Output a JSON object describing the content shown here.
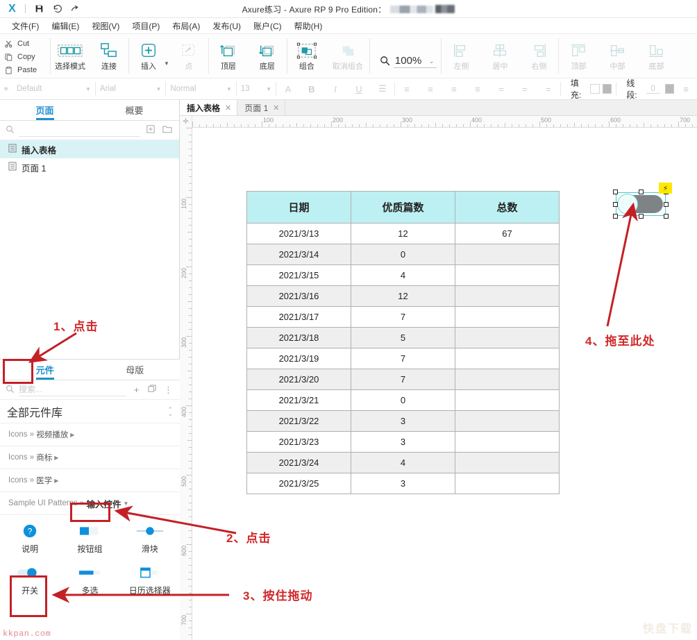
{
  "window": {
    "title": "Axure练习 - Axure RP 9 Pro Edition：",
    "logo": "X",
    "icons": {
      "save": "save-icon",
      "undo": "undo-icon",
      "redo": "redo-icon"
    }
  },
  "menubar": {
    "items": [
      {
        "label": "文件(F)",
        "name": "menu-file"
      },
      {
        "label": "编辑(E)",
        "name": "menu-edit"
      },
      {
        "label": "视图(V)",
        "name": "menu-view"
      },
      {
        "label": "项目(P)",
        "name": "menu-project"
      },
      {
        "label": "布局(A)",
        "name": "menu-layout"
      },
      {
        "label": "发布(U)",
        "name": "menu-publish"
      },
      {
        "label": "账户(C)",
        "name": "menu-account"
      },
      {
        "label": "帮助(H)",
        "name": "menu-help"
      }
    ]
  },
  "toolbar": {
    "clipboard": [
      {
        "label": "Cut",
        "icon": "scissors-icon"
      },
      {
        "label": "Copy",
        "icon": "copy-icon"
      },
      {
        "label": "Paste",
        "icon": "paste-icon"
      }
    ],
    "buttons": [
      {
        "label": "选择模式",
        "icon": "selection-mode-icon",
        "disabled": false
      },
      {
        "label": "连接",
        "icon": "connect-icon",
        "disabled": false
      },
      {
        "label": "插入",
        "icon": "insert-plus-icon",
        "disabled": false
      },
      {
        "label": "点",
        "icon": "point-icon",
        "disabled": true
      },
      {
        "label": "顶层",
        "icon": "bring-to-front-icon",
        "disabled": false
      },
      {
        "label": "底层",
        "icon": "send-to-back-icon",
        "disabled": false
      },
      {
        "label": "组合",
        "icon": "group-icon",
        "disabled": false
      },
      {
        "label": "取消组合",
        "icon": "ungroup-icon",
        "disabled": true
      },
      {
        "label": "左侧",
        "icon": "align-left-icon",
        "disabled": true
      },
      {
        "label": "居中",
        "icon": "align-center-icon",
        "disabled": true
      },
      {
        "label": "右侧",
        "icon": "align-right-icon",
        "disabled": true
      },
      {
        "label": "顶部",
        "icon": "align-top-icon",
        "disabled": true
      },
      {
        "label": "中部",
        "icon": "align-middle-icon",
        "disabled": true
      },
      {
        "label": "底部",
        "icon": "align-bottom-icon",
        "disabled": true
      }
    ],
    "zoom": {
      "value": "100%",
      "icon": "magnifier-icon"
    }
  },
  "formatbar": {
    "style": "Default",
    "font": "Arial",
    "weight": "Normal",
    "size": "13",
    "fill_label": "填充:",
    "line_label": "线段:",
    "line_width": "0"
  },
  "left_panel": {
    "top_tabs": [
      {
        "label": "页面",
        "active": true,
        "name": "tab-pages"
      },
      {
        "label": "概要",
        "active": false,
        "name": "tab-outline"
      }
    ],
    "page_search_placeholder": "",
    "pages": [
      {
        "label": "插入表格",
        "selected": true
      },
      {
        "label": "页面 1",
        "selected": false
      }
    ],
    "bottom_tabs": [
      {
        "label": "元件",
        "active": true,
        "name": "tab-widgets"
      },
      {
        "label": "母版",
        "active": false,
        "name": "tab-masters"
      }
    ],
    "widget_search_placeholder": "搜索...",
    "library_selected": "全部元件库",
    "library_groups": [
      {
        "prefix": "Icons »",
        "name": "视频播放",
        "current": false
      },
      {
        "prefix": "Icons »",
        "name": "商标",
        "current": false
      },
      {
        "prefix": "Icons »",
        "name": "医学",
        "current": false
      },
      {
        "prefix": "Sample UI Patterns »",
        "name": "输入控件",
        "current": true
      }
    ],
    "widgets": [
      {
        "label": "说明",
        "icon": "question-badge-icon"
      },
      {
        "label": "按钮组",
        "icon": "button-group-icon"
      },
      {
        "label": "滑块",
        "icon": "slider-icon"
      },
      {
        "label": "开关",
        "icon": "toggle-switch-icon",
        "highlighted": true
      },
      {
        "label": "多选",
        "icon": "multi-select-icon"
      },
      {
        "label": "日历选择器",
        "icon": "date-picker-icon"
      }
    ]
  },
  "canvas": {
    "tabs": [
      {
        "label": "插入表格",
        "active": true
      },
      {
        "label": "页面 1",
        "active": false
      }
    ],
    "ruler_h_labels": [
      "100",
      "200",
      "300",
      "400",
      "500",
      "600",
      "700"
    ],
    "ruler_v_labels": [
      "100",
      "200",
      "300",
      "400",
      "500",
      "600",
      "700"
    ],
    "selected_widget": {
      "name": "toggle-switch-widget",
      "badge": "⚡"
    }
  },
  "chart_data": {
    "type": "table",
    "title": "",
    "columns": [
      "日期",
      "优质篇数",
      "总数"
    ],
    "rows": [
      [
        "2021/3/13",
        "12",
        "67"
      ],
      [
        "2021/3/14",
        "0",
        ""
      ],
      [
        "2021/3/15",
        "4",
        ""
      ],
      [
        "2021/3/16",
        "12",
        ""
      ],
      [
        "2021/3/17",
        "7",
        ""
      ],
      [
        "2021/3/18",
        "5",
        ""
      ],
      [
        "2021/3/19",
        "7",
        ""
      ],
      [
        "2021/3/20",
        "7",
        ""
      ],
      [
        "2021/3/21",
        "0",
        ""
      ],
      [
        "2021/3/22",
        "3",
        ""
      ],
      [
        "2021/3/23",
        "3",
        ""
      ],
      [
        "2021/3/24",
        "4",
        ""
      ],
      [
        "2021/3/25",
        "3",
        ""
      ]
    ],
    "header_color": "#bdf0f2",
    "alt_row_color": "#efefef"
  },
  "annotations": {
    "accent_color": "#d0282a",
    "items": [
      {
        "id": "a1",
        "text": "1、点击"
      },
      {
        "id": "a2",
        "text": "2、点击"
      },
      {
        "id": "a3",
        "text": "3、按住拖动"
      },
      {
        "id": "a4",
        "text": "4、拖至此处"
      }
    ]
  },
  "watermarks": {
    "left": "kkpan.com",
    "right": "快盘下载"
  }
}
